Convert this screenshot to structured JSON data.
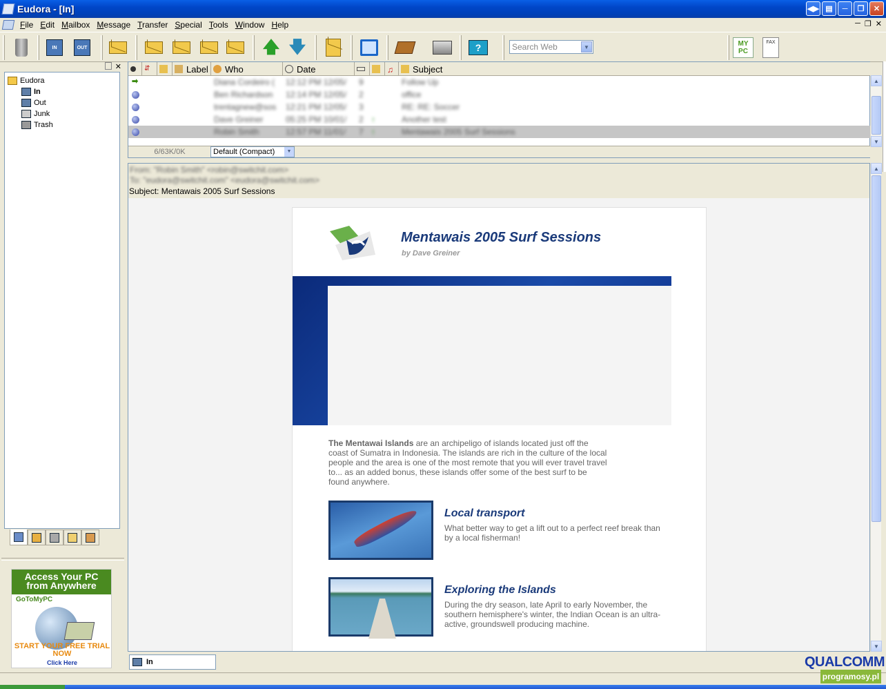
{
  "window": {
    "title": "Eudora - [In]"
  },
  "menu": [
    "File",
    "Edit",
    "Mailbox",
    "Message",
    "Transfer",
    "Special",
    "Tools",
    "Window",
    "Help"
  ],
  "toolbar": {
    "search_placeholder": "Search Web"
  },
  "toolbar_icons": [
    "trash-icon",
    "check-mail-icon",
    "send-queued-icon",
    "new-message-icon",
    "reply-icon",
    "reply-all-icon",
    "forward-icon",
    "redirect-icon",
    "previous-message-icon",
    "next-message-icon",
    "attach-file-icon",
    "find-icon",
    "address-book-icon",
    "print-icon",
    "help-icon",
    "mypc-icon",
    "fax-icon"
  ],
  "mailboxes": {
    "root": "Eudora",
    "items": [
      "In",
      "Out",
      "Junk",
      "Trash"
    ]
  },
  "list": {
    "columns": {
      "label": "Label",
      "who": "Who",
      "date": "Date",
      "subject": "Subject"
    },
    "rows": [
      {
        "who": "Diana Cordeiro (",
        "date": "12:12 PM 12/05/",
        "size": "9",
        "subject": "Follow Up"
      },
      {
        "who": "Ben Richardson",
        "date": "12:14 PM 12/05/",
        "size": "2",
        "subject": "office"
      },
      {
        "who": "trentagnew@sos",
        "date": "12:21 PM 12/05/",
        "size": "3",
        "subject": "RE: RE: Soccer"
      },
      {
        "who": "Dave Greiner",
        "date": "05:25 PM 10/01/",
        "size": "2",
        "subject": "Another test"
      },
      {
        "who": "Robin Smith",
        "date": "12:57 PM 11/01/",
        "size": "7",
        "subject": "Mentawais 2005 Surf Sessions"
      }
    ],
    "count": "6/63K/0K",
    "view": "Default (Compact)"
  },
  "preview": {
    "from": "From: \"Robin Smith\" <robin@switchit.com>",
    "to": "To: \"eudora@switchit.com\" <eudora@switchit.com>",
    "subject": "Subject: Mentawais 2005 Surf Sessions",
    "email": {
      "title": "Mentawais 2005 Surf Sessions",
      "byline": "by Dave Greiner",
      "intro_bold": "The Mentawai Islands",
      "intro_rest": " are an archipeligo of islands located just off the coast of Sumatra in Indonesia. The islands are rich in the culture of the local people and the area is one of the most remote that you will ever travel travel to... as an added bonus, these islands offer some of the best surf to be found anywhere.",
      "features": [
        {
          "title": "Local transport",
          "text": "What better way to get a lift out to a perfect reef break than by a local fisherman!"
        },
        {
          "title": "Exploring the Islands",
          "text": "During the dry season, late April to early November, the southern hemisphere's winter, the Indian Ocean is an ultra-active, groundswell producing machine."
        }
      ]
    }
  },
  "ad": {
    "headline": "Access Your PC from Anywhere",
    "brand": "GoToMyPC",
    "cta": "START YOUR FREE TRIAL NOW",
    "click": "Click Here"
  },
  "mypc_label": "MY PC",
  "fax_label": "FAX",
  "status": {
    "mailbox": "In"
  },
  "brand": "QUALCOMM",
  "watermark": "programosy.pl"
}
